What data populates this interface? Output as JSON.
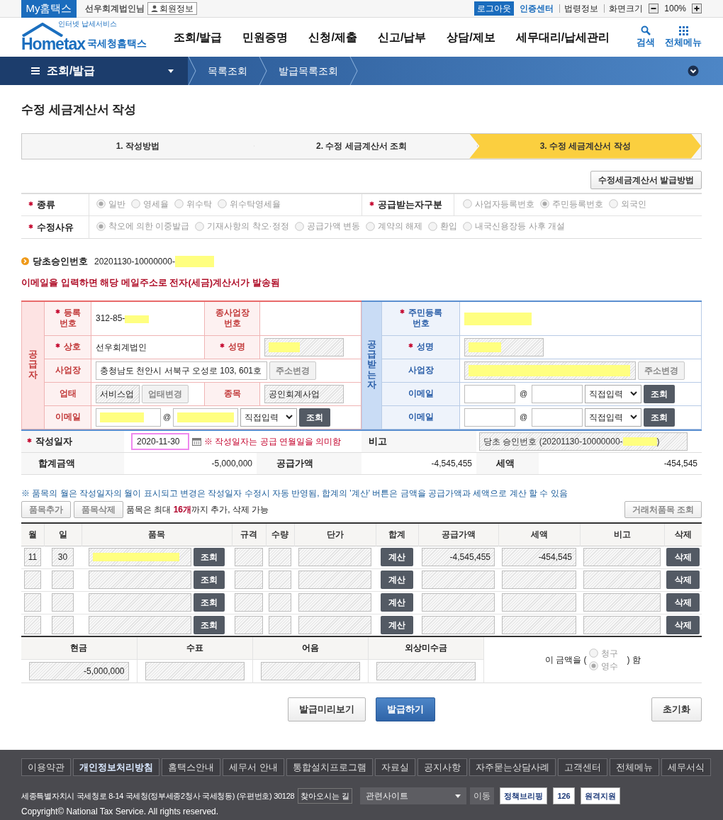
{
  "top_bar": {
    "brand": "My홈택스",
    "user": "선우회계법인님",
    "member_info": "회원정보",
    "logout": "로그아웃",
    "certificate_center": "인증센터",
    "links": [
      "법령정보",
      "화면크기"
    ],
    "zoom": "100%"
  },
  "header": {
    "logo_tagline": "인터넷 납세서비스",
    "logo": "Hometax",
    "logo_title": "국세청홈택스",
    "menu": [
      "조회/발급",
      "민원증명",
      "신청/제출",
      "신고/납부",
      "상담/제보",
      "세무대리/납세관리"
    ],
    "search": "검색",
    "all_menu": "전체메뉴"
  },
  "nav": {
    "section": "조회/발급",
    "breadcrumb": [
      "목록조회",
      "발급목록조회"
    ]
  },
  "page_title": "수정 세금계산서 작성",
  "steps": [
    {
      "label": "1. 작성방법",
      "selected": false
    },
    {
      "label": "2. 수정 세금계산서 조회",
      "selected": false
    },
    {
      "label": "3. 수정 세금계산서 작성",
      "selected": true
    }
  ],
  "guide_button": "수정세금계산서 발급방법",
  "options": [
    {
      "label": "종류",
      "required": true,
      "radios": [
        {
          "label": "일반",
          "selected": true
        },
        {
          "label": "영세율",
          "selected": false
        },
        {
          "label": "위수탁",
          "selected": false
        },
        {
          "label": "위수탁영세율",
          "selected": false
        }
      ]
    },
    {
      "label": "공급받는자구분",
      "required": true,
      "radios": [
        {
          "label": "사업자등록번호",
          "selected": false
        },
        {
          "label": "주민등록번호",
          "selected": true
        },
        {
          "label": "외국인",
          "selected": false
        }
      ]
    },
    {
      "label": "수정사유",
      "required": true,
      "radios": [
        {
          "label": "착오에 의한 이중발급",
          "selected": true
        },
        {
          "label": "기재사항의 착오·정정",
          "selected": false
        },
        {
          "label": "공급가액 변동",
          "selected": false
        },
        {
          "label": "계약의 해제",
          "selected": false
        },
        {
          "label": "환입",
          "selected": false
        },
        {
          "label": "내국신용장등 사후 개설",
          "selected": false
        }
      ]
    }
  ],
  "original_approval": {
    "label": "당초승인번호",
    "value": "20201130-10000000-",
    "redacted": true
  },
  "email_notice": "이메일을 입력하면 해당 메일주소로 전자(세금)계산서가 발송됨",
  "supplier": {
    "title": "공급자",
    "reg_no": {
      "label": "등록\n번호",
      "required": true,
      "value": "312-85-",
      "redacted": true
    },
    "branch_no": {
      "label": "종사업장\n번호",
      "required": false
    },
    "company": {
      "label": "상호",
      "required": true,
      "value": "선우회계법인"
    },
    "representative": {
      "label": "성명",
      "required": true,
      "redacted": true
    },
    "address": {
      "label": "사업장",
      "value": "충청남도 천안시 서북구 오성로 103, 601호",
      "button": "주소변경"
    },
    "business_type": {
      "label": "업태",
      "value": "서비스업",
      "button": "업태변경"
    },
    "business_item": {
      "label": "종목",
      "value": "공인회계사업"
    },
    "email": {
      "label": "이메일",
      "local_redacted": true,
      "at": "@",
      "domain_redacted": true,
      "select": "직접입력",
      "button": "조회"
    }
  },
  "receiver": {
    "title": "공급받는자",
    "id_no": {
      "label": "주민등록\n번호",
      "required": true,
      "redacted": true
    },
    "name": {
      "label": "성명",
      "required": true,
      "redacted": true
    },
    "address": {
      "label": "사업장",
      "redacted": true,
      "button": "주소변경"
    },
    "emails": [
      {
        "label": "이메일",
        "at": "@",
        "select": "직접입력",
        "button": "조회"
      },
      {
        "label": "이메일",
        "at": "@",
        "select": "직접입력",
        "button": "조회"
      }
    ]
  },
  "issue_date": {
    "label": "작성일자",
    "required": true,
    "value": "2020-11-30",
    "note": "※ 작성일자는 공급 연월일을 의미함"
  },
  "remarks": {
    "label": "비고",
    "value_prefix": "당초 승인번호 (20201130-10000000-",
    "redacted": true,
    "value_suffix": ")"
  },
  "totals": [
    {
      "label": "합계금액",
      "value": "-5,000,000"
    },
    {
      "label": "공급가액",
      "value": "-4,545,455"
    },
    {
      "label": "세액",
      "value": "-454,545"
    }
  ],
  "items_notice": "※ 품목의 월은 작성일자의 월이 표시되고 변경은 작성일자 수정시 자동 반영됨, 합계의 '계산' 버튼은 금액을 공급가액과 세액으로 계산 할 수 있음",
  "item_buttons": [
    "품목추가",
    "품목삭제"
  ],
  "item_limit": "품목은 최대 **16개**까지 추가, 삭제 가능",
  "partner_items_button": "거래처품목 조회",
  "items_table": {
    "columns": [
      "월",
      "일",
      "품목",
      "규격",
      "수량",
      "단가",
      "합계",
      "공급가액",
      "세액",
      "비고",
      "삭제"
    ],
    "rows": [
      {
        "month": "11",
        "day": "30",
        "item_redacted": true,
        "lookup": "조회",
        "calc": "계산",
        "supply": "-4,545,455",
        "tax": "-454,545",
        "delete": "삭제"
      },
      {
        "item_redacted": false,
        "lookup": "조회",
        "calc": "계산",
        "delete": "삭제"
      },
      {
        "item_redacted": false,
        "lookup": "조회",
        "calc": "계산",
        "delete": "삭제"
      },
      {
        "item_redacted": false,
        "lookup": "조회",
        "calc": "계산",
        "delete": "삭제"
      }
    ]
  },
  "payment": [
    {
      "label": "현금",
      "value": "-5,000,000"
    },
    {
      "label": "수표"
    },
    {
      "label": "어음"
    },
    {
      "label": "외상미수금"
    }
  ],
  "receipt": {
    "prefix": "이 금액을 (",
    "radios": [
      {
        "label": "청구",
        "selected": false
      },
      {
        "label": "영수",
        "selected": true
      }
    ],
    "suffix": ") 함"
  },
  "actions": [
    {
      "label": "발급미리보기",
      "kind": "secondary"
    },
    {
      "label": "발급하기",
      "kind": "primary"
    }
  ],
  "reset_button": "초기화",
  "footer": {
    "links": [
      {
        "label": "이용약관",
        "emphasized": false
      },
      {
        "label": "개인정보처리방침",
        "emphasized": true
      },
      {
        "label": "홈택스안내",
        "emphasized": false
      },
      {
        "label": "세무서 안내",
        "emphasized": false
      },
      {
        "label": "통합설치프로그램",
        "emphasized": false
      },
      {
        "label": "자료실",
        "emphasized": false
      },
      {
        "label": "공지사항",
        "emphasized": false
      },
      {
        "label": "자주묻는상담사례",
        "emphasized": false
      },
      {
        "label": "고객센터",
        "emphasized": false
      },
      {
        "label": "전체메뉴",
        "emphasized": false
      },
      {
        "label": "세무서식",
        "emphasized": false
      }
    ],
    "address": "세종특별자치시 국세청로 8-14 국세청(정부세종2청사 국세청동) (우편번호) 30128",
    "directions": "찾아오시는 길",
    "related_sites": "관련사이트",
    "go": "이동",
    "banners": [
      "정책브리핑",
      "126",
      "원격지원"
    ],
    "copyright": "Copyright© National Tax Service. All rights reserved."
  }
}
